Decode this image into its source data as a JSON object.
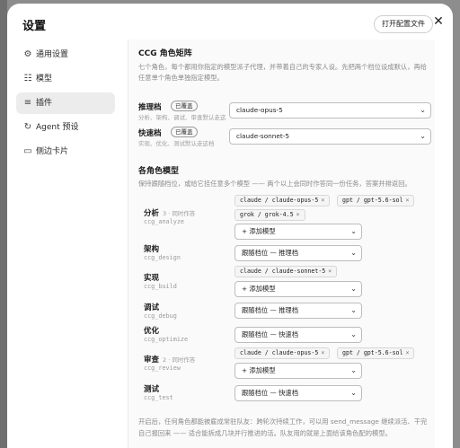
{
  "dialog": {
    "title": "设置",
    "open_config_label": "打开配置文件",
    "close_glyph": "✕"
  },
  "sidebar": {
    "items": [
      {
        "label": "通用设置",
        "icon": "gear-icon",
        "glyph": "⚙"
      },
      {
        "label": "模型",
        "icon": "database-icon",
        "glyph": "☷"
      },
      {
        "label": "插件",
        "icon": "sliders-icon",
        "glyph": "≡",
        "active": true
      },
      {
        "label": "Agent 预设",
        "icon": "refresh-icon",
        "glyph": "↻"
      },
      {
        "label": "侧边卡片",
        "icon": "card-icon",
        "glyph": "▭"
      }
    ]
  },
  "ccg": {
    "title": "CCG 角色矩阵",
    "description": "七个角色，每个都用你指定的模型派子代理，并带着自己的专家人设。先把两个档位设成默认，再给任意单个角色单独指定模型。",
    "tiers": [
      {
        "name": "推理档",
        "badge": "已覆盖",
        "sub": "分析、架构、调试、审查默认走这档",
        "value": "claude-opus-5"
      },
      {
        "name": "快速档",
        "badge": "已覆盖",
        "sub": "实现、优化、测试默认走这档",
        "value": "claude-sonnet-5"
      }
    ],
    "roles_title": "各角色模型",
    "roles_description": "保持跟随档位，或给它挂任意多个模型 —— 两个以上会同时作答同一份任务，答案并排返回。",
    "add_model_label": "+ 添加模型",
    "roles": [
      {
        "name": "分析",
        "note": "3 · 同时作答",
        "id": "ccg_analyze",
        "chips": [
          "claude / claude-opus-5",
          "gpt / gpt-5.6-sol",
          "grok / grok-4.5"
        ]
      },
      {
        "name": "架构",
        "id": "ccg_design",
        "follow": "跟随档位 — 推理档"
      },
      {
        "name": "实现",
        "id": "ccg_build",
        "chips": [
          "claude / claude-sonnet-5"
        ]
      },
      {
        "name": "调试",
        "id": "ccg_debug",
        "follow": "跟随档位 — 推理档"
      },
      {
        "name": "优化",
        "id": "ccg_optimize",
        "follow": "跟随档位 — 快速档"
      },
      {
        "name": "审查",
        "note": "2 · 同时作答",
        "id": "ccg_review",
        "chips": [
          "claude / claude-opus-5",
          "gpt / gpt-5.6-sol"
        ]
      },
      {
        "name": "测试",
        "id": "ccg_test",
        "follow": "跟随档位 — 快速档"
      }
    ],
    "footer": "开启后，任何角色都能被雇成常驻队友：跨轮次持续工作，可以用 send_message 继续派活、干完自己报回来 —— 适合能拆成几块并行推进的活。队友用的就是上面给该角色配的模型。"
  }
}
